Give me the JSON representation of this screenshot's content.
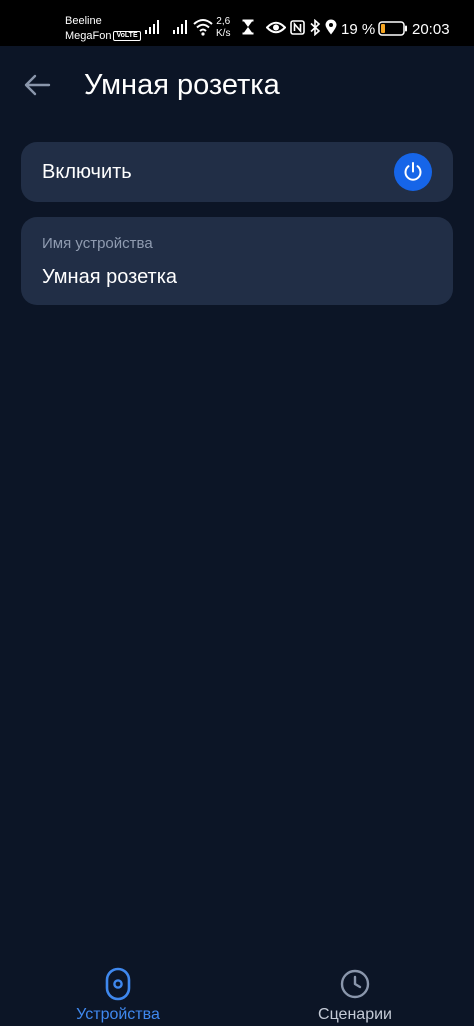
{
  "status_bar": {
    "carrier_1": "Beeline",
    "carrier_2": "MegaFon",
    "volte_badge": "VoLTE",
    "net_speed_value": "2,6",
    "net_speed_unit": "K/s",
    "battery_percent": "19 %",
    "battery_level": 0.19,
    "time": "20:03",
    "icons": [
      "signal-icon",
      "signal-icon",
      "wifi-icon",
      "hourglass-icon",
      "eye-icon",
      "nfc-icon",
      "bluetooth-icon",
      "location-icon",
      "battery-icon"
    ]
  },
  "header": {
    "back_icon": "arrow-left-icon",
    "title": "Умная розетка"
  },
  "power_card": {
    "label": "Включить",
    "icon": "power-icon",
    "accent_color": "#1665e8"
  },
  "name_card": {
    "field_label": "Имя устройства",
    "value": "Умная розетка"
  },
  "bottom_nav": {
    "items": [
      {
        "label": "Устройства",
        "icon": "device-icon",
        "active": true,
        "color": "#3f88ee"
      },
      {
        "label": "Сценарии",
        "icon": "clock-icon",
        "active": false,
        "color": "#c4cad6"
      }
    ]
  },
  "colors": {
    "background": "#0c1526",
    "card": "#212e46",
    "status_bar": "#000000"
  }
}
